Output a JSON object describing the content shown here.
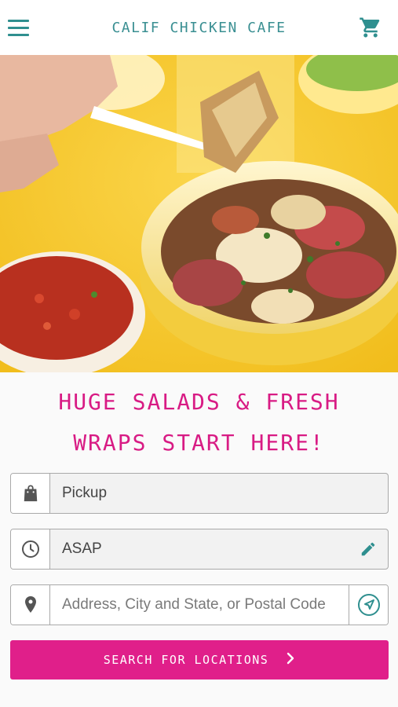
{
  "header": {
    "brand": "CALIF CHICKEN CAFE",
    "menu_icon": "hamburger-menu-icon",
    "cart_icon": "shopping-cart-icon"
  },
  "hero": {
    "image": "photo of roasted potatoes in a bowl, salsa cup, on yellow table"
  },
  "headline": {
    "line1": "HUGE SALADS & FRESH",
    "line2": "WRAPS START HERE!"
  },
  "order_type": {
    "icon": "shopping-bag-icon",
    "value": "Pickup"
  },
  "order_time": {
    "icon": "clock-icon",
    "value": "ASAP",
    "edit_icon": "pencil-icon"
  },
  "address": {
    "icon": "map-pin-icon",
    "placeholder": "Address, City and State, or Postal Code",
    "locate_icon": "navigation-arrow-icon"
  },
  "search": {
    "label": "SEARCH FOR LOCATIONS",
    "icon": "chevron-right-icon"
  },
  "colors": {
    "accent_teal": "#2f8f8f",
    "accent_pink": "#e01f8a",
    "headline_pink": "#d81b84",
    "hero_yellow": "#f5c832"
  }
}
